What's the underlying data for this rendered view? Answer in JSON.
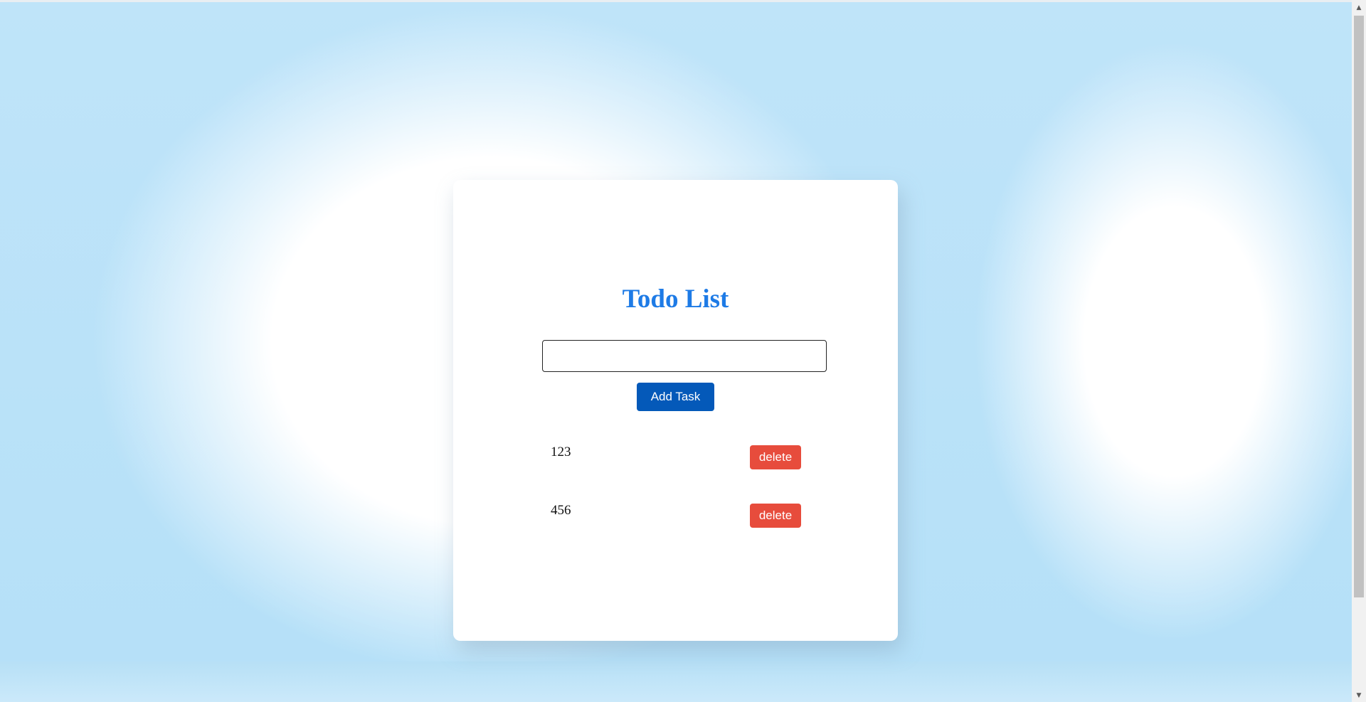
{
  "app": {
    "title": "Todo List"
  },
  "form": {
    "input_value": "",
    "input_placeholder": "",
    "add_label": "Add Task"
  },
  "tasks": [
    {
      "text": "123",
      "delete_label": "delete"
    },
    {
      "text": "456",
      "delete_label": "delete"
    }
  ],
  "colors": {
    "title": "#1e7be6",
    "add_button": "#0459b9",
    "delete_button": "#e74c3c"
  }
}
